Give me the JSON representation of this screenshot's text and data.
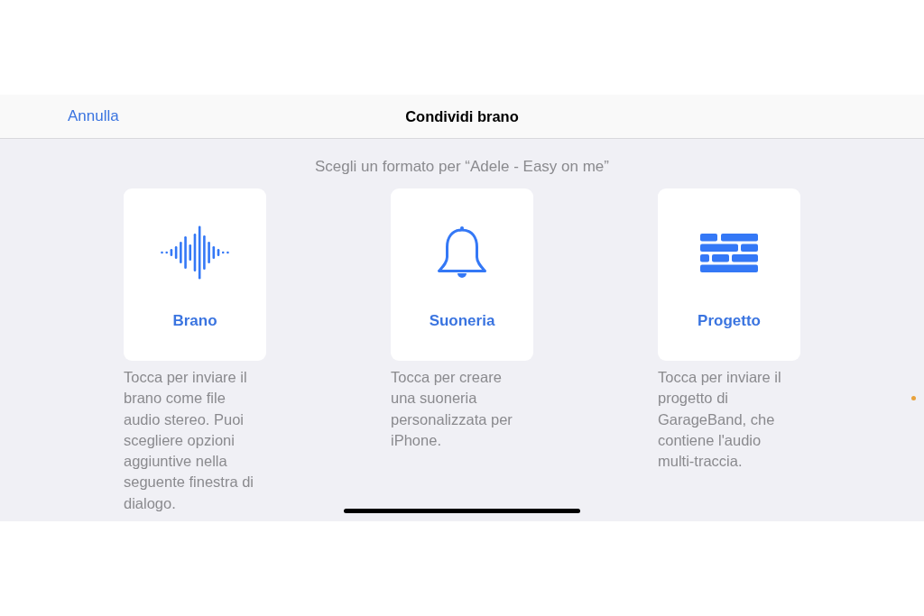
{
  "nav_bar": {
    "cancel": "Annulla",
    "title": "Condividi brano"
  },
  "prompt": "Scegli un formato per “Adele - Easy on me”",
  "formats": [
    {
      "kind": "song",
      "label": "Brano",
      "description_lines": [
        "Tocca per inviare il",
        "brano come file",
        "audio stereo. Puoi",
        "scegliere opzioni",
        "aggiuntive nella",
        "seguente finestra di",
        "dialogo."
      ]
    },
    {
      "kind": "ringtone",
      "label": "Suoneria",
      "description_lines": [
        "Tocca per creare",
        "una suoneria",
        "personalizzata per",
        "iPhone."
      ]
    },
    {
      "kind": "project",
      "label": "Progetto",
      "description_lines": [
        "Tocca per inviare il",
        "progetto di",
        "GarageBand, che",
        "contiene l'audio",
        "multi-traccia."
      ]
    }
  ]
}
